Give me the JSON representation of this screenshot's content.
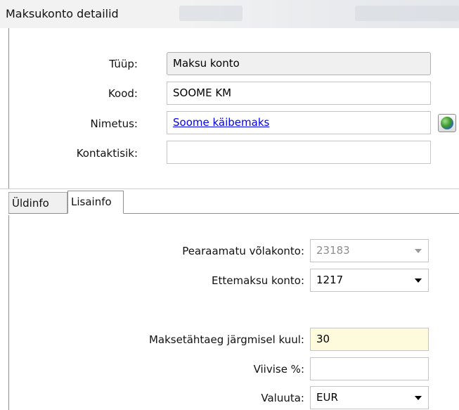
{
  "window": {
    "title": "Maksukonto detailid"
  },
  "header_form": {
    "type_label": "Tüüp:",
    "type_value": "Maksu konto",
    "code_label": "Kood:",
    "code_value": "SOOME KM",
    "name_label": "Nimetus:",
    "name_value": "Soome käibemaks",
    "contact_label": "Kontaktisik:",
    "contact_value": "",
    "globe_icon": "globe-icon"
  },
  "tabs": [
    {
      "label": "Üldinfo",
      "active": false
    },
    {
      "label": "Lisainfo",
      "active": true
    }
  ],
  "lisainfo": {
    "ledger_label": "Pearaamatu võlakonto:",
    "ledger_value": "23183",
    "prepay_label": "Ettemaksu konto:",
    "prepay_value": "1217",
    "due_label": "Maksetähtaeg järgmisel kuul:",
    "due_value": "30",
    "penalty_label": "Viivise %:",
    "penalty_value": "",
    "currency_label": "Valuuta:",
    "currency_value": "EUR"
  },
  "colors": {
    "highlight_field": "#fdfbdc",
    "link": "#0000ee",
    "readonly_field": "#f0f0f0"
  }
}
